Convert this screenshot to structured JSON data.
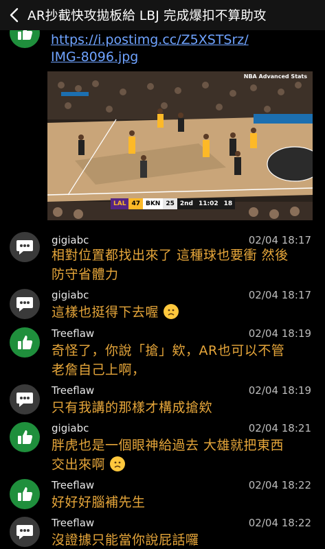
{
  "header": {
    "title": "AR抄截快攻拋板給 LBJ 完成爆扣不算助攻"
  },
  "attachment": {
    "link_line1": "https://i.postimg.cc/Z5XSTSrz/",
    "link_line2": "IMG-8096.jpg",
    "watermark": "NBA Advanced Stats",
    "scorebug": {
      "away": "LAL",
      "away_score": "47",
      "home": "BKN",
      "home_score": "25",
      "quarter": "2nd",
      "clock": "11:02",
      "shot_clock": "18"
    }
  },
  "messages": [
    {
      "user": "gigiabc",
      "time": "02/04 18:17",
      "text": "相對位置都找出來了 這種球也要衝 然後",
      "text2": "防守省體力",
      "avatar": "comment-icon"
    },
    {
      "user": "gigiabc",
      "time": "02/04 18:17",
      "text": "這樣也挺得下去喔",
      "avatar": "comment-icon",
      "emoji": "frowning-face"
    },
    {
      "user": "Treeflaw",
      "time": "02/04 18:19",
      "text": "奇怪了，你說「搶」欸，AR也可以不管",
      "text2": "老詹自己上啊，",
      "avatar": "thumbs-up-icon"
    },
    {
      "user": "Treeflaw",
      "time": "02/04 18:19",
      "text": "只有我講的那樣才構成搶欸",
      "avatar": "comment-icon"
    },
    {
      "user": "gigiabc",
      "time": "02/04 18:21",
      "text": "胖虎也是一個眼神給過去 大雄就把東西",
      "text2": "交出來啊",
      "avatar": "thumbs-up-icon",
      "emoji": "frowning-face"
    },
    {
      "user": "Treeflaw",
      "time": "02/04 18:22",
      "text": "好好好腦補先生",
      "avatar": "thumbs-up-icon"
    },
    {
      "user": "Treeflaw",
      "time": "02/04 18:22",
      "text": "沒證據只能當你說屁話囉",
      "avatar": "comment-icon"
    }
  ]
}
